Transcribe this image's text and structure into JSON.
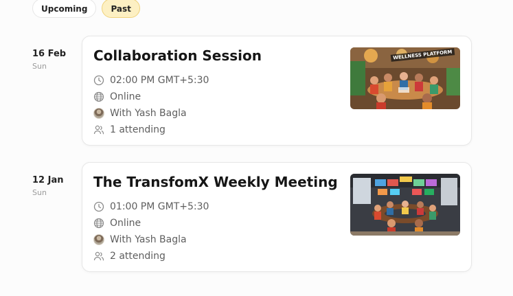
{
  "tabs": {
    "upcoming": "Upcoming",
    "past": "Past",
    "active": "past"
  },
  "events": [
    {
      "date": "16 Feb",
      "weekday": "Sun",
      "title": "Collaboration Session",
      "time": "02:00 PM GMT+5:30",
      "location": "Online",
      "host": "With Yash Bagla",
      "attending": "1 attending",
      "thumbnail_sign": "WELLNESS PLATFORM"
    },
    {
      "date": "12 Jan",
      "weekday": "Sun",
      "title": "The TransfomX Weekly Meeting",
      "time": "01:00 PM GMT+5:30",
      "location": "Online",
      "host": "With Yash Bagla",
      "attending": "2 attending"
    }
  ],
  "icons": {
    "time": "clock-icon",
    "location": "globe-icon",
    "host": "avatar",
    "attending": "users-icon"
  },
  "colors": {
    "active_tab_bg": "#fdf0c3",
    "active_tab_border": "#f0d27a"
  }
}
